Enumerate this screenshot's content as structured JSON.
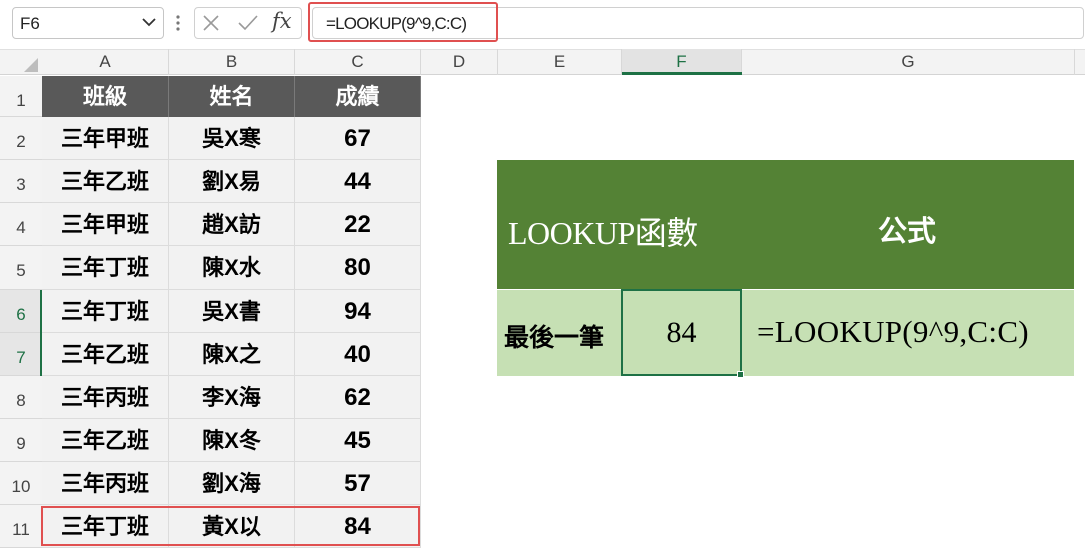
{
  "formula_bar": {
    "name_box": "F6",
    "formula": "=LOOKUP(9^9,C:C)",
    "fx_label": "fx"
  },
  "columns": [
    "A",
    "B",
    "C",
    "D",
    "E",
    "F",
    "G"
  ],
  "rows": [
    "1",
    "2",
    "3",
    "4",
    "5",
    "6",
    "7",
    "8",
    "9",
    "10",
    "11"
  ],
  "table": {
    "headers": [
      "班級",
      "姓名",
      "成績"
    ],
    "rows": [
      [
        "三年甲班",
        "吳X寒",
        "67"
      ],
      [
        "三年乙班",
        "劉X易",
        "44"
      ],
      [
        "三年甲班",
        "趙X訪",
        "22"
      ],
      [
        "三年丁班",
        "陳X水",
        "80"
      ],
      [
        "三年丁班",
        "吳X書",
        "94"
      ],
      [
        "三年乙班",
        "陳X之",
        "40"
      ],
      [
        "三年丙班",
        "李X海",
        "62"
      ],
      [
        "三年乙班",
        "陳X冬",
        "45"
      ],
      [
        "三年丙班",
        "劉X海",
        "57"
      ],
      [
        "三年丁班",
        "黃X以",
        "84"
      ]
    ]
  },
  "panel": {
    "header_function": "LOOKUP函數",
    "header_formula": "公式",
    "label": "最後一筆",
    "value": "84",
    "formula_text": "=LOOKUP(9^9,C:C)"
  },
  "colors": {
    "header_dark": "#595959",
    "panel_header": "#548235",
    "panel_body": "#c6e0b4",
    "selection": "#1e7145",
    "highlight": "#e05050"
  }
}
